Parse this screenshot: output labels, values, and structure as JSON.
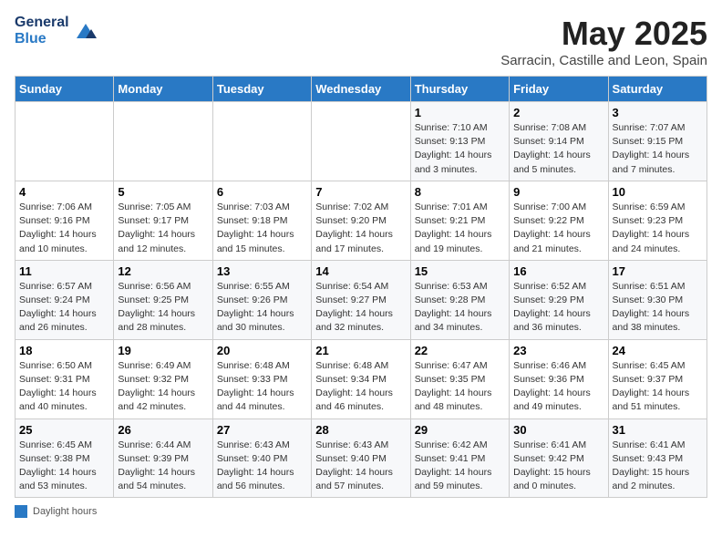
{
  "header": {
    "logo_general": "General",
    "logo_blue": "Blue",
    "title": "May 2025",
    "subtitle": "Sarracin, Castille and Leon, Spain"
  },
  "days_of_week": [
    "Sunday",
    "Monday",
    "Tuesday",
    "Wednesday",
    "Thursday",
    "Friday",
    "Saturday"
  ],
  "weeks": [
    [
      {
        "num": "",
        "info": ""
      },
      {
        "num": "",
        "info": ""
      },
      {
        "num": "",
        "info": ""
      },
      {
        "num": "",
        "info": ""
      },
      {
        "num": "1",
        "info": "Sunrise: 7:10 AM\nSunset: 9:13 PM\nDaylight: 14 hours\nand 3 minutes."
      },
      {
        "num": "2",
        "info": "Sunrise: 7:08 AM\nSunset: 9:14 PM\nDaylight: 14 hours\nand 5 minutes."
      },
      {
        "num": "3",
        "info": "Sunrise: 7:07 AM\nSunset: 9:15 PM\nDaylight: 14 hours\nand 7 minutes."
      }
    ],
    [
      {
        "num": "4",
        "info": "Sunrise: 7:06 AM\nSunset: 9:16 PM\nDaylight: 14 hours\nand 10 minutes."
      },
      {
        "num": "5",
        "info": "Sunrise: 7:05 AM\nSunset: 9:17 PM\nDaylight: 14 hours\nand 12 minutes."
      },
      {
        "num": "6",
        "info": "Sunrise: 7:03 AM\nSunset: 9:18 PM\nDaylight: 14 hours\nand 15 minutes."
      },
      {
        "num": "7",
        "info": "Sunrise: 7:02 AM\nSunset: 9:20 PM\nDaylight: 14 hours\nand 17 minutes."
      },
      {
        "num": "8",
        "info": "Sunrise: 7:01 AM\nSunset: 9:21 PM\nDaylight: 14 hours\nand 19 minutes."
      },
      {
        "num": "9",
        "info": "Sunrise: 7:00 AM\nSunset: 9:22 PM\nDaylight: 14 hours\nand 21 minutes."
      },
      {
        "num": "10",
        "info": "Sunrise: 6:59 AM\nSunset: 9:23 PM\nDaylight: 14 hours\nand 24 minutes."
      }
    ],
    [
      {
        "num": "11",
        "info": "Sunrise: 6:57 AM\nSunset: 9:24 PM\nDaylight: 14 hours\nand 26 minutes."
      },
      {
        "num": "12",
        "info": "Sunrise: 6:56 AM\nSunset: 9:25 PM\nDaylight: 14 hours\nand 28 minutes."
      },
      {
        "num": "13",
        "info": "Sunrise: 6:55 AM\nSunset: 9:26 PM\nDaylight: 14 hours\nand 30 minutes."
      },
      {
        "num": "14",
        "info": "Sunrise: 6:54 AM\nSunset: 9:27 PM\nDaylight: 14 hours\nand 32 minutes."
      },
      {
        "num": "15",
        "info": "Sunrise: 6:53 AM\nSunset: 9:28 PM\nDaylight: 14 hours\nand 34 minutes."
      },
      {
        "num": "16",
        "info": "Sunrise: 6:52 AM\nSunset: 9:29 PM\nDaylight: 14 hours\nand 36 minutes."
      },
      {
        "num": "17",
        "info": "Sunrise: 6:51 AM\nSunset: 9:30 PM\nDaylight: 14 hours\nand 38 minutes."
      }
    ],
    [
      {
        "num": "18",
        "info": "Sunrise: 6:50 AM\nSunset: 9:31 PM\nDaylight: 14 hours\nand 40 minutes."
      },
      {
        "num": "19",
        "info": "Sunrise: 6:49 AM\nSunset: 9:32 PM\nDaylight: 14 hours\nand 42 minutes."
      },
      {
        "num": "20",
        "info": "Sunrise: 6:48 AM\nSunset: 9:33 PM\nDaylight: 14 hours\nand 44 minutes."
      },
      {
        "num": "21",
        "info": "Sunrise: 6:48 AM\nSunset: 9:34 PM\nDaylight: 14 hours\nand 46 minutes."
      },
      {
        "num": "22",
        "info": "Sunrise: 6:47 AM\nSunset: 9:35 PM\nDaylight: 14 hours\nand 48 minutes."
      },
      {
        "num": "23",
        "info": "Sunrise: 6:46 AM\nSunset: 9:36 PM\nDaylight: 14 hours\nand 49 minutes."
      },
      {
        "num": "24",
        "info": "Sunrise: 6:45 AM\nSunset: 9:37 PM\nDaylight: 14 hours\nand 51 minutes."
      }
    ],
    [
      {
        "num": "25",
        "info": "Sunrise: 6:45 AM\nSunset: 9:38 PM\nDaylight: 14 hours\nand 53 minutes."
      },
      {
        "num": "26",
        "info": "Sunrise: 6:44 AM\nSunset: 9:39 PM\nDaylight: 14 hours\nand 54 minutes."
      },
      {
        "num": "27",
        "info": "Sunrise: 6:43 AM\nSunset: 9:40 PM\nDaylight: 14 hours\nand 56 minutes."
      },
      {
        "num": "28",
        "info": "Sunrise: 6:43 AM\nSunset: 9:40 PM\nDaylight: 14 hours\nand 57 minutes."
      },
      {
        "num": "29",
        "info": "Sunrise: 6:42 AM\nSunset: 9:41 PM\nDaylight: 14 hours\nand 59 minutes."
      },
      {
        "num": "30",
        "info": "Sunrise: 6:41 AM\nSunset: 9:42 PM\nDaylight: 15 hours\nand 0 minutes."
      },
      {
        "num": "31",
        "info": "Sunrise: 6:41 AM\nSunset: 9:43 PM\nDaylight: 15 hours\nand 2 minutes."
      }
    ]
  ],
  "footer": {
    "daylight_label": "Daylight hours"
  }
}
